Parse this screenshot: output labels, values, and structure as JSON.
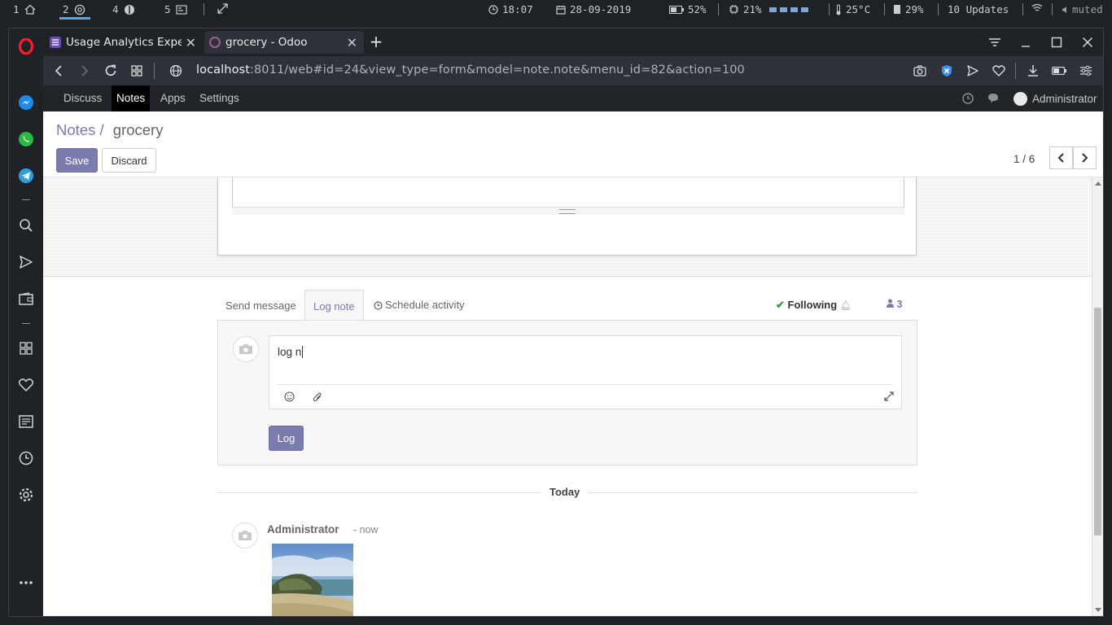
{
  "system": {
    "workspaces": [
      {
        "num": "1",
        "icon": "home-icon"
      },
      {
        "num": "2",
        "icon": "chrome-icon"
      },
      {
        "num": "4",
        "icon": "leaf-icon"
      },
      {
        "num": "5",
        "icon": "terminal-icon"
      }
    ],
    "active_workspace": "2",
    "time": "18:07",
    "date": "28-09-2019",
    "battery": "52%",
    "cpu": "21%",
    "temperature": "25°C",
    "memory": "29%",
    "updates": "10 Updates",
    "volume": "muted"
  },
  "browser": {
    "tabs": [
      {
        "title": "Usage Analytics Experiment",
        "favicon_color": "#6e4fb0",
        "active": false
      },
      {
        "title": "grocery - Odoo",
        "favicon_color": "#a35b9a",
        "active": true
      }
    ],
    "url_host": "localhost",
    "url_rest": ":8011/web#id=24&view_type=form&model=note.note&menu_id=82&action=100"
  },
  "odoo": {
    "menu": [
      "Discuss",
      "Notes",
      "Apps",
      "Settings"
    ],
    "active_menu": "Notes",
    "user": "Administrator",
    "breadcrumb": {
      "parent": "Notes",
      "separator": "/",
      "current": "grocery"
    },
    "buttons": {
      "save": "Save",
      "discard": "Discard"
    },
    "pager": "1 / 6",
    "chatter": {
      "tabs": {
        "send": "Send message",
        "log": "Log note",
        "schedule": "Schedule activity"
      },
      "following": "Following",
      "followers": "3",
      "composer_text": "log n",
      "log_button": "Log",
      "separator": "Today",
      "message": {
        "author": "Administrator",
        "date": "- now"
      }
    }
  },
  "colors": {
    "brand": "#7c7bad",
    "odoo_menu": "#212529",
    "browser_chrome": "#2e3238"
  }
}
